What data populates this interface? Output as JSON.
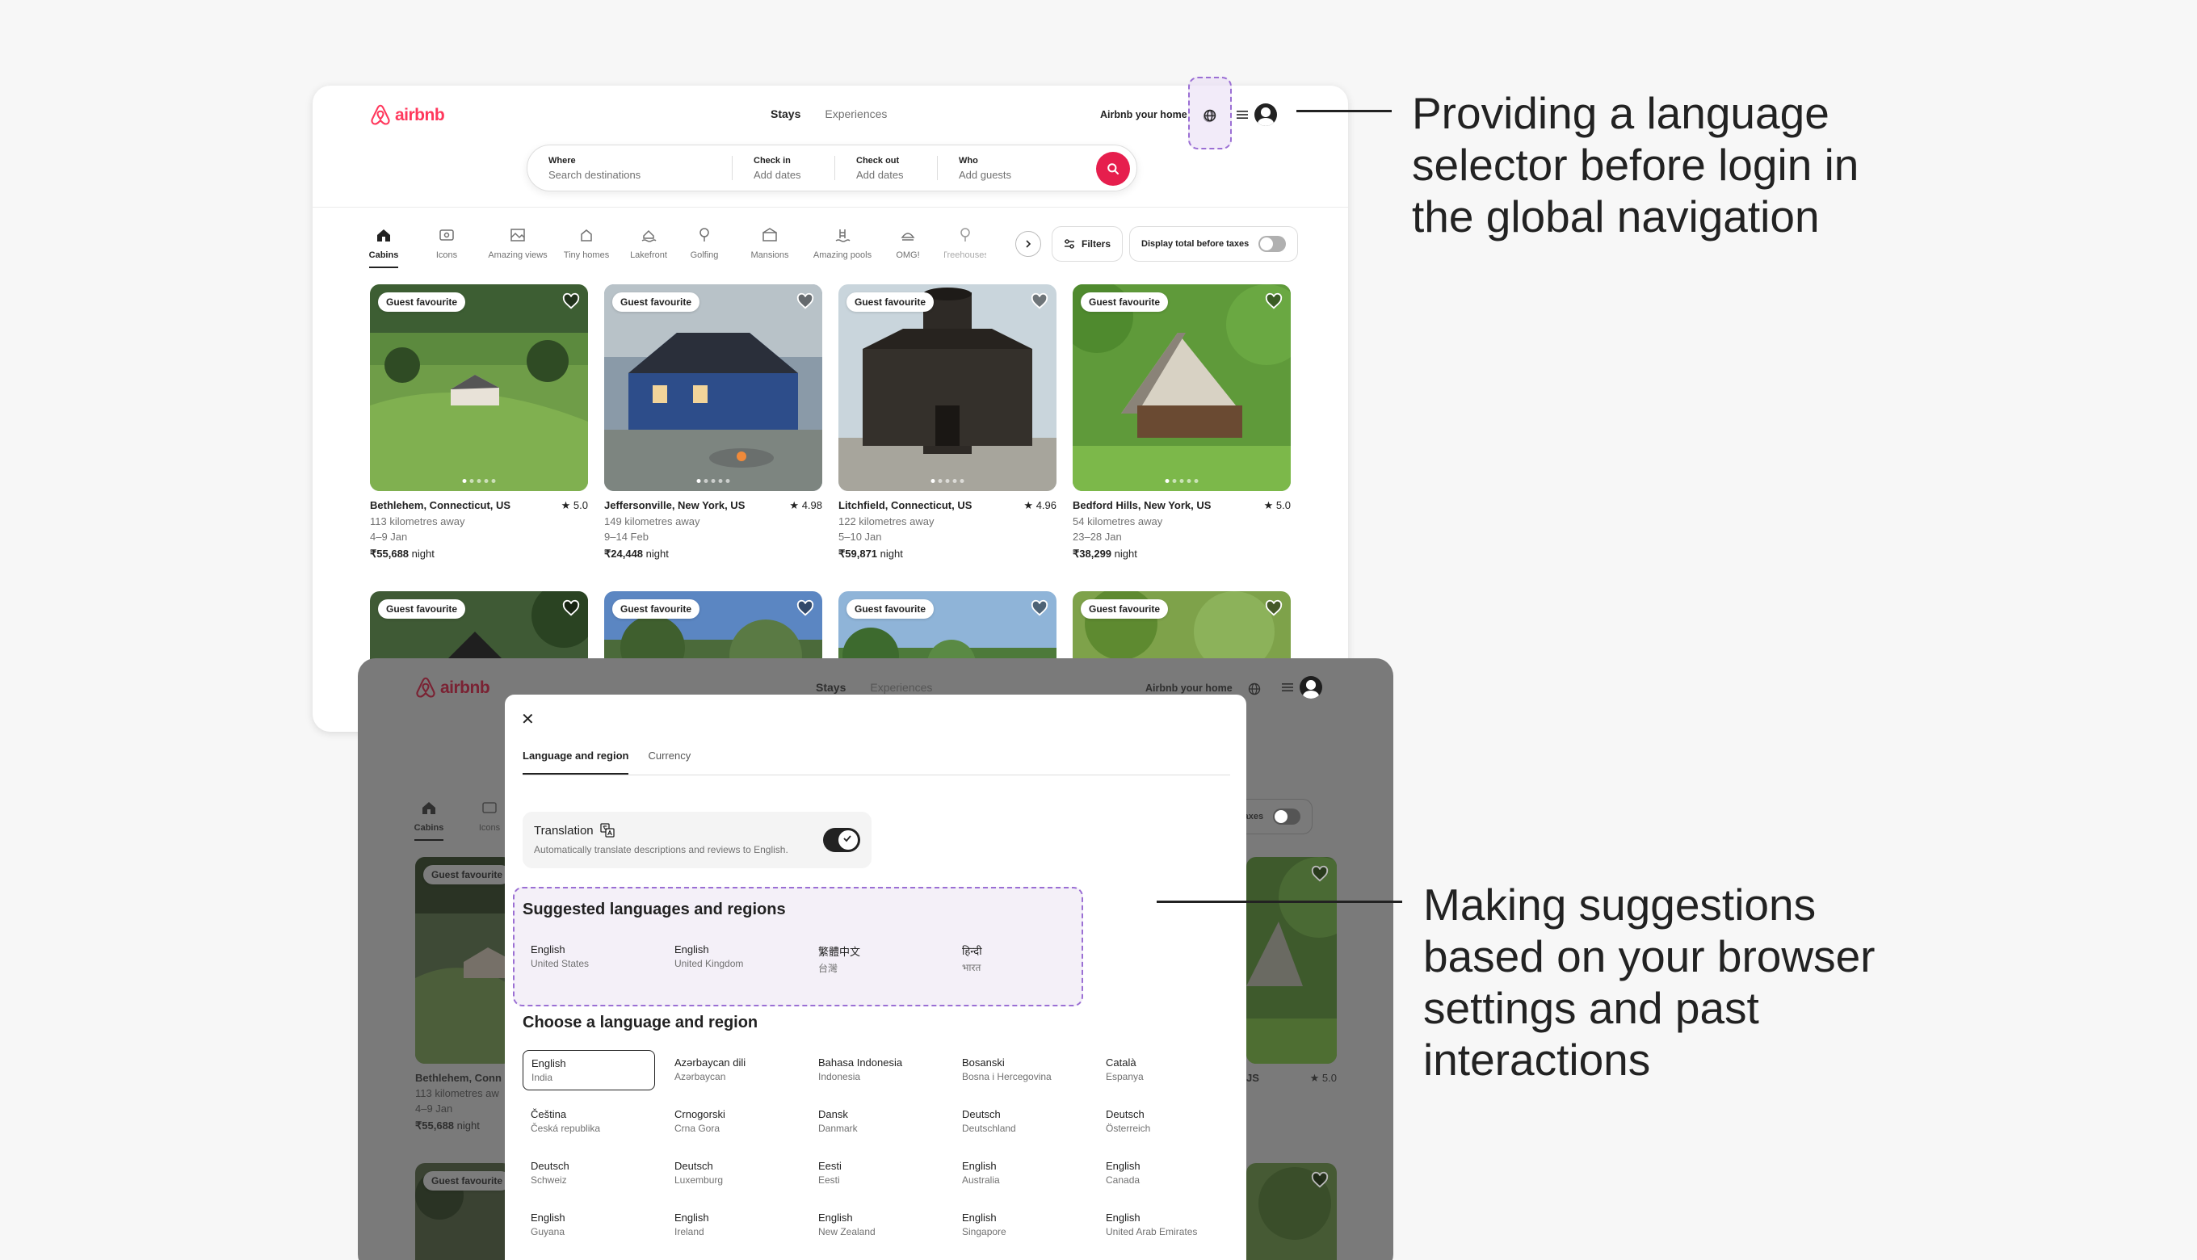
{
  "brand": {
    "name": "airbnb",
    "accent": "#ff385c"
  },
  "nav": {
    "tabs": [
      "Stays",
      "Experiences"
    ],
    "host_link": "Airbnb your home"
  },
  "search": {
    "where_label": "Where",
    "where_placeholder": "Search destinations",
    "checkin_label": "Check in",
    "checkin_placeholder": "Add dates",
    "checkout_label": "Check out",
    "checkout_placeholder": "Add dates",
    "who_label": "Who",
    "who_placeholder": "Add guests"
  },
  "categories": [
    {
      "label": "Cabins",
      "icon": "cabin-icon"
    },
    {
      "label": "Icons",
      "icon": "icons-icon"
    },
    {
      "label": "Amazing views",
      "icon": "views-icon"
    },
    {
      "label": "Tiny homes",
      "icon": "tiny-home-icon"
    },
    {
      "label": "Lakefront",
      "icon": "lakefront-icon"
    },
    {
      "label": "Golfing",
      "icon": "golf-icon"
    },
    {
      "label": "Mansions",
      "icon": "mansion-icon"
    },
    {
      "label": "Amazing pools",
      "icon": "pool-icon"
    },
    {
      "label": "OMG!",
      "icon": "omg-icon"
    },
    {
      "label": "Treehouses",
      "icon": "treehouse-icon"
    }
  ],
  "filters_label": "Filters",
  "taxes_label": "Display total before taxes",
  "badge_label": "Guest favourite",
  "listings": [
    {
      "title": "Bethlehem, Connecticut, US",
      "rating": "★ 5.0",
      "distance": "113 kilometres away",
      "dates": "4–9 Jan",
      "price": "₹55,688",
      "unit": " night"
    },
    {
      "title": "Jeffersonville, New York, US",
      "rating": "★ 4.98",
      "distance": "149 kilometres away",
      "dates": "9–14 Feb",
      "price": "₹24,448",
      "unit": " night"
    },
    {
      "title": "Litchfield, Connecticut, US",
      "rating": "★ 4.96",
      "distance": "122 kilometres away",
      "dates": "5–10 Jan",
      "price": "₹59,871",
      "unit": " night"
    },
    {
      "title": "Bedford Hills, New York, US",
      "rating": "★ 5.0",
      "distance": "54 kilometres away",
      "dates": "23–28 Jan",
      "price": "₹38,299",
      "unit": " night"
    }
  ],
  "back_window": {
    "cat_labels": [
      "Cabins",
      "Icons"
    ],
    "badge": "Guest favourite",
    "left_title": "Bethlehem, Conn",
    "left_distance": "113 kilometres aw",
    "left_dates": "4–9 Jan",
    "left_price": "₹55,688",
    "left_unit": " night",
    "taxes_partial": "efore taxes",
    "right_title_partial": "JS",
    "right_rating": "★ 5.0"
  },
  "modal": {
    "close": "✕",
    "tabs": [
      "Language and region",
      "Currency"
    ],
    "translation_title": "Translation",
    "translation_desc": "Automatically translate descriptions and reviews to English.",
    "suggested_title": "Suggested languages and regions",
    "suggested": [
      {
        "lang": "English",
        "region": "United States"
      },
      {
        "lang": "English",
        "region": "United Kingdom"
      },
      {
        "lang": "繁體中文",
        "region": "台灣"
      },
      {
        "lang": "हिन्दी",
        "region": "भारत"
      }
    ],
    "choose_title": "Choose a language and region",
    "languages": [
      {
        "lang": "English",
        "region": "India"
      },
      {
        "lang": "Azərbaycan dili",
        "region": "Azərbaycan"
      },
      {
        "lang": "Bahasa Indonesia",
        "region": "Indonesia"
      },
      {
        "lang": "Bosanski",
        "region": "Bosna i Hercegovina"
      },
      {
        "lang": "Català",
        "region": "Espanya"
      },
      {
        "lang": "Čeština",
        "region": "Česká republika"
      },
      {
        "lang": "Crnogorski",
        "region": "Crna Gora"
      },
      {
        "lang": "Dansk",
        "region": "Danmark"
      },
      {
        "lang": "Deutsch",
        "region": "Deutschland"
      },
      {
        "lang": "Deutsch",
        "region": "Österreich"
      },
      {
        "lang": "Deutsch",
        "region": "Schweiz"
      },
      {
        "lang": "Deutsch",
        "region": "Luxemburg"
      },
      {
        "lang": "Eesti",
        "region": "Eesti"
      },
      {
        "lang": "English",
        "region": "Australia"
      },
      {
        "lang": "English",
        "region": "Canada"
      },
      {
        "lang": "English",
        "region": "Guyana"
      },
      {
        "lang": "English",
        "region": "Ireland"
      },
      {
        "lang": "English",
        "region": "New Zealand"
      },
      {
        "lang": "English",
        "region": "Singapore"
      },
      {
        "lang": "English",
        "region": "United Arab Emirates"
      }
    ]
  },
  "annotations": {
    "callout_1": [
      "Providing a language",
      "selector before login in",
      "the global navigation"
    ],
    "callout_2": [
      "Making suggestions",
      "based on your browser",
      "settings and past",
      "interactions"
    ],
    "highlight_color": "#9b6fd4"
  }
}
